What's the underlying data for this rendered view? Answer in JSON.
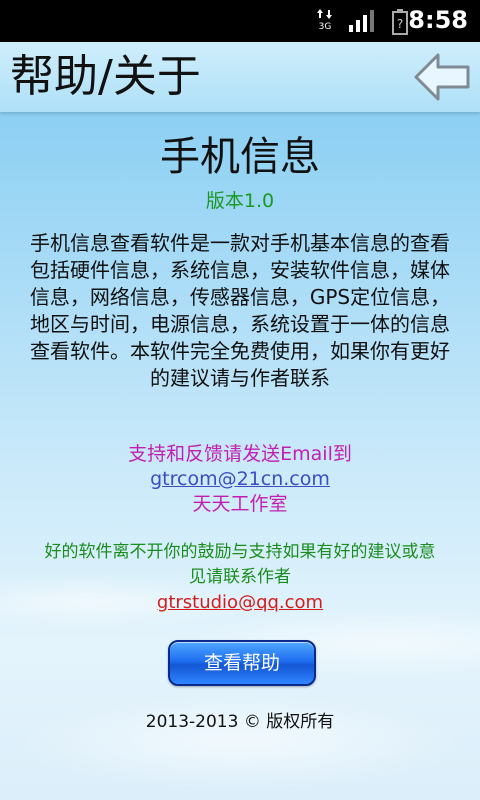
{
  "status_bar": {
    "network": "3G",
    "time": "8:58"
  },
  "header": {
    "title": "帮助/关于",
    "back_icon": "back-arrow-icon"
  },
  "app": {
    "name": "手机信息",
    "version": "版本1.0",
    "description": "手机信息查看软件是一款对手机基本信息的查看包括硬件信息，系统信息，安装软件信息，媒体信息，网络信息，传感器信息，GPS定位信息，地区与时间，电源信息，系统设置于一体的信息查看软件。本软件完全免费使用，如果你有更好的建议请与作者联系"
  },
  "support": {
    "text": "支持和反馈请发送Email到",
    "email": "gtrcom@21cn.com",
    "studio": "天天工作室"
  },
  "encourage": {
    "text": "好的软件离不开你的鼓励与支持如果有好的建议或意见请联系作者",
    "email": "gtrstudio@qq.com"
  },
  "buttons": {
    "help_label": "查看帮助"
  },
  "footer": {
    "copyright": "2013-2013 © 版权所有"
  },
  "colors": {
    "version": "#1a9a22",
    "support": "#c21fb2",
    "link_blue": "#3a4fbf",
    "encourage": "#1b8d1f",
    "link_red": "#d21d1d",
    "button": "#1f6ff0"
  }
}
